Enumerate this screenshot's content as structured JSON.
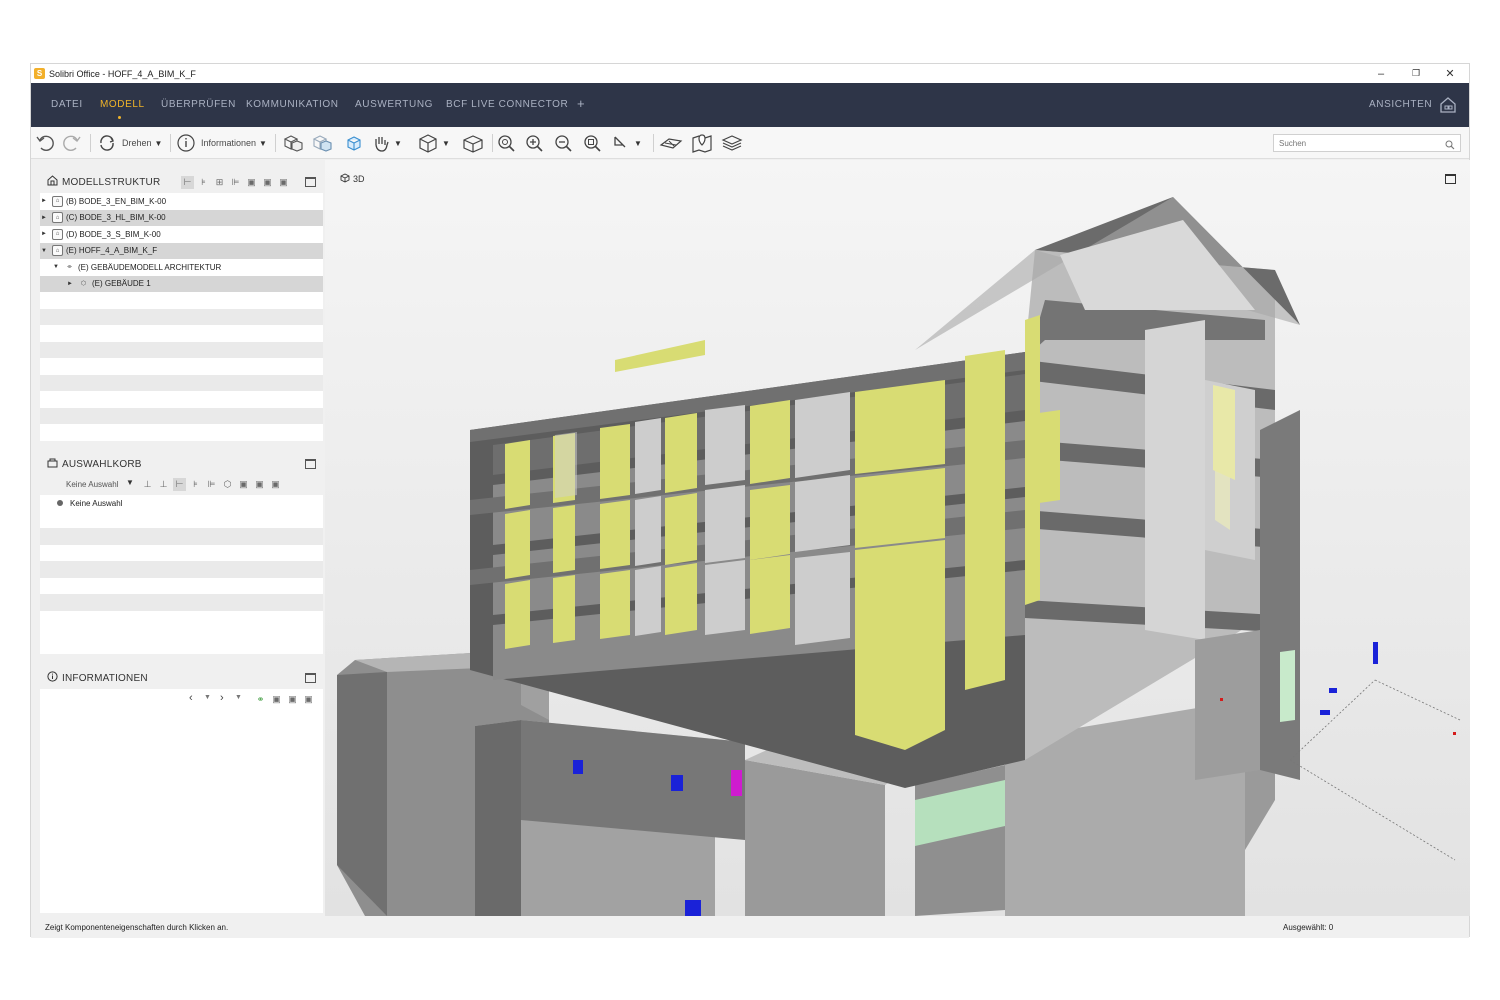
{
  "window": {
    "title": "Solibri Office - HOFF_4_A_BIM_K_F",
    "app_icon": "S",
    "controls": [
      "–",
      "❐",
      "✕"
    ]
  },
  "menubar": {
    "items": [
      "DATEI",
      "MODELL",
      "ÜBERPRÜFEN",
      "KOMMUNIKATION",
      "AUSWERTUNG",
      "BCF LIVE CONNECTOR",
      "+"
    ],
    "active": "MODELL",
    "right_label": "ANSICHTEN",
    "accent": "#f0b429",
    "background": "#2e3548"
  },
  "toolbar": {
    "rotate_label": "Drehen",
    "info_label": "Informationen",
    "search_placeholder": "Suchen"
  },
  "modellstruktur": {
    "title": "MODELLSTRUKTUR",
    "tree": [
      {
        "label": "(B) BODE_3_EN_BIM_K-00",
        "expander": "►",
        "icon": "building-model-icon",
        "indent": 0
      },
      {
        "label": "(C) BODE_3_HL_BIM_K-00",
        "expander": "►",
        "icon": "building-model-icon",
        "indent": 0
      },
      {
        "label": "(D) BODE_3_S_BIM_K-00",
        "expander": "►",
        "icon": "building-model-icon",
        "indent": 0
      },
      {
        "label": "(E) HOFF_4_A_BIM_K_F",
        "expander": "▼",
        "icon": "building-model-icon",
        "indent": 0
      },
      {
        "label": "(E) GEBÄUDEMODELL ARCHITEKTUR",
        "expander": "▼",
        "icon": "site-icon",
        "indent": 1
      },
      {
        "label": "(E) GEBÄUDE 1",
        "expander": "►",
        "icon": "cube-icon",
        "indent": 2
      }
    ]
  },
  "auswahlkorb": {
    "title": "AUSWAHLKORB",
    "dropdown": "Keine Auswahl",
    "item": "Keine Auswahl"
  },
  "informationen": {
    "title": "INFORMATIONEN"
  },
  "viewport": {
    "label": "3D"
  },
  "status": {
    "left": "Zeigt Komponenteneigenschaften durch Klicken an.",
    "right": "Ausgewählt: 0"
  }
}
